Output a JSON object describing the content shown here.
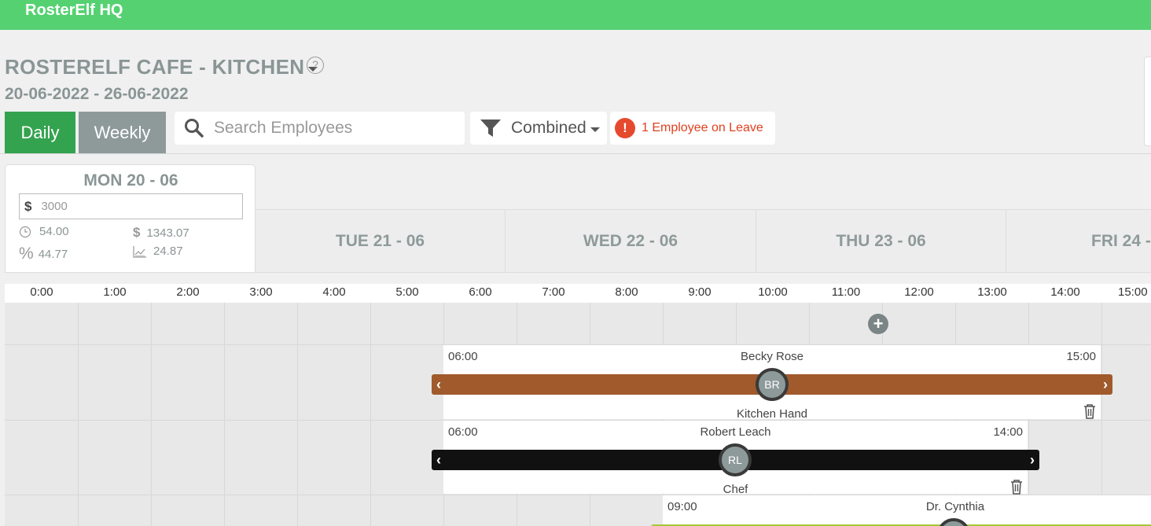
{
  "app": {
    "title": "RosterElf HQ"
  },
  "header": {
    "location": "ROSTERELF CAFE - KITCHEN",
    "date_range": "20-06-2022 - 26-06-2022",
    "help_label": "?"
  },
  "toolbar": {
    "daily_label": "Daily",
    "weekly_label": "Weekly",
    "search_placeholder": "Search Employees",
    "filter_label": "Combined",
    "leave_icon": "!",
    "leave_label": "1 Employee on Leave"
  },
  "selected_day": {
    "title": "MON 20 - 06",
    "budget_currency": "$",
    "budget_value": "3000",
    "hours": "54.00",
    "cost": "1343.07",
    "percent": "44.77",
    "ratio": "24.87"
  },
  "days": [
    {
      "label": "TUE 21 - 06"
    },
    {
      "label": "WED 22 - 06"
    },
    {
      "label": "THU 23 - 06"
    },
    {
      "label": "FRI 24 -"
    }
  ],
  "hours": [
    "0:00",
    "1:00",
    "2:00",
    "3:00",
    "4:00",
    "5:00",
    "6:00",
    "7:00",
    "8:00",
    "9:00",
    "10:00",
    "11:00",
    "12:00",
    "13:00",
    "14:00",
    "15:00"
  ],
  "shifts": [
    {
      "start": "06:00",
      "end": "15:00",
      "name": "Becky Rose",
      "initials": "BR",
      "role": "Kitchen Hand",
      "color": "#a05a2c"
    },
    {
      "start": "06:00",
      "end": "14:00",
      "name": "Robert Leach",
      "initials": "RL",
      "role": "Chef",
      "color": "#111111"
    },
    {
      "start": "09:00",
      "end": "",
      "name": "Dr. Cynthia",
      "initials": "",
      "role": "",
      "color": "#a6c83a"
    }
  ],
  "icons": {
    "search": "search-icon",
    "filter": "filter-icon",
    "clock": "clock-icon",
    "dollar": "dollar-icon",
    "percent": "percent-icon",
    "chart": "chart-icon",
    "trash": "trash-icon",
    "add": "add-icon"
  }
}
